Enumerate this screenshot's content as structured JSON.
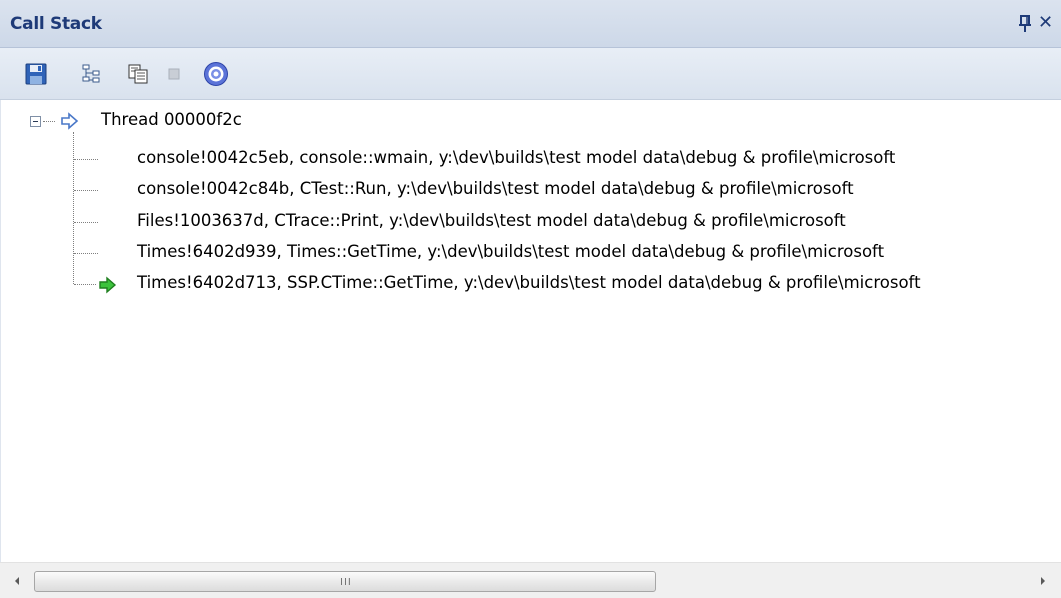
{
  "window": {
    "title": "Call Stack",
    "pin_icon": "pin-icon",
    "close_label": "✕"
  },
  "toolbar": {
    "buttons": [
      {
        "icon": "save-icon"
      },
      {
        "icon": "tree-view-icon"
      },
      {
        "icon": "copy-icon"
      },
      {
        "icon": "stop-icon"
      },
      {
        "icon": "help-icon"
      }
    ]
  },
  "tree": {
    "thread": {
      "label": "Thread 00000f2c",
      "expanded": true,
      "icon": "thread-arrow-icon"
    },
    "frames": [
      {
        "text": "console!0042c5eb, console::wmain, y:\\dev\\builds\\test model data\\debug & profile\\microsoft",
        "current": false
      },
      {
        "text": "console!0042c84b, CTest::Run, y:\\dev\\builds\\test model data\\debug & profile\\microsoft",
        "current": false
      },
      {
        "text": "Files!1003637d, CTrace::Print, y:\\dev\\builds\\test model data\\debug & profile\\microsoft",
        "current": false
      },
      {
        "text": "Times!6402d939, Times::GetTime, y:\\dev\\builds\\test model data\\debug & profile\\microsoft",
        "current": false
      },
      {
        "text": "Times!6402d713, SSP.CTime::GetTime, y:\\dev\\builds\\test model data\\debug & profile\\microsoft",
        "current": true
      }
    ]
  },
  "scrollbar": {
    "grip": "III",
    "thumb_fraction": 0.63
  },
  "colors": {
    "title_text": "#1e3a78",
    "current_frame_arrow": "#2fa52f",
    "thread_arrow": "#4a78c8"
  }
}
